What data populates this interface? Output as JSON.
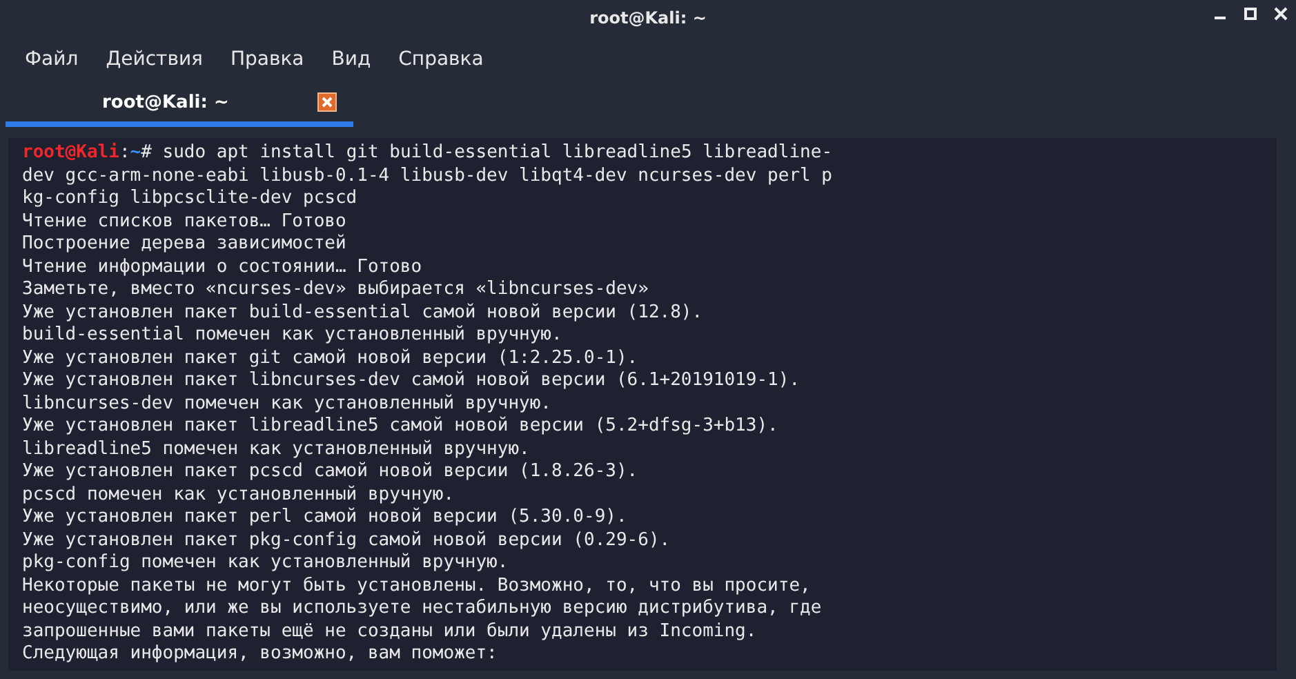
{
  "window": {
    "title": "root@Kali: ~"
  },
  "menu": [
    "Файл",
    "Действия",
    "Правка",
    "Вид",
    "Справка"
  ],
  "tabs": [
    {
      "label": "root@Kali: ~",
      "selected": true
    }
  ],
  "terminal": {
    "prompt": {
      "user": "root@Kali",
      "separator": ":",
      "path": "~",
      "symbol": "#",
      "command": " sudo apt install git build-essential libreadline5 libreadline-"
    },
    "lines": [
      "dev gcc-arm-none-eabi libusb-0.1-4 libusb-dev libqt4-dev ncurses-dev perl p",
      "kg-config libpcsclite-dev pcscd",
      "Чтение списков пакетов… Готово",
      "Построение дерева зависимостей",
      "Чтение информации о состоянии… Готово",
      "Заметьте, вместо «ncurses-dev» выбирается «libncurses-dev»",
      "Уже установлен пакет build-essential самой новой версии (12.8).",
      "build-essential помечен как установленный вручную.",
      "Уже установлен пакет git самой новой версии (1:2.25.0-1).",
      "Уже установлен пакет libncurses-dev самой новой версии (6.1+20191019-1).",
      "libncurses-dev помечен как установленный вручную.",
      "Уже установлен пакет libreadline5 самой новой версии (5.2+dfsg-3+b13).",
      "libreadline5 помечен как установленный вручную.",
      "Уже установлен пакет pcscd самой новой версии (1.8.26-3).",
      "pcscd помечен как установленный вручную.",
      "Уже установлен пакет perl самой новой версии (5.30.0-9).",
      "Уже установлен пакет pkg-config самой новой версии (0.29-6).",
      "pkg-config помечен как установленный вручную.",
      "Некоторые пакеты не могут быть установлены. Возможно, то, что вы просите,",
      "неосуществимо, или же вы используете нестабильную версию дистрибутива, где",
      "запрошенные вами пакеты ещё не созданы или были удалены из Incoming.",
      "Следующая информация, возможно, вам поможет:"
    ]
  }
}
